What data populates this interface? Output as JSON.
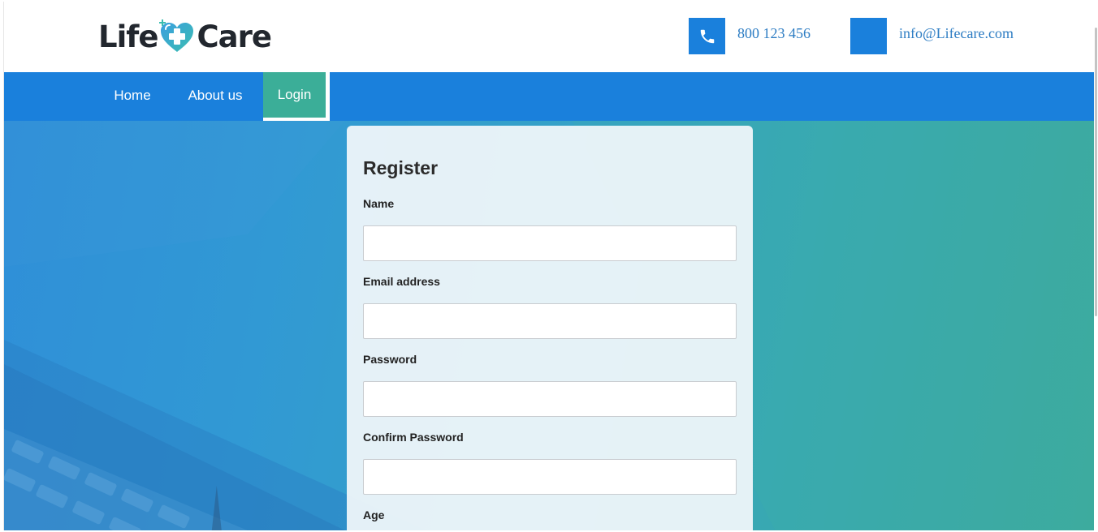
{
  "logo": {
    "part1": "Life",
    "part2": "Care",
    "heart_color": "#3aaed8",
    "cross_color": "#ffffff"
  },
  "contact": {
    "phone": "800 123 456",
    "email": "info@Lifecare.com",
    "phone_icon": "phone-icon",
    "email_icon": "mail-icon",
    "accent": "#1a80dc"
  },
  "nav": {
    "items": [
      {
        "label": "Home"
      },
      {
        "label": "About us"
      },
      {
        "label": "Login",
        "active": true
      }
    ],
    "background": "#1a80dc",
    "active_color": "#3bae98"
  },
  "register": {
    "title": "Register",
    "fields": [
      {
        "label": "Name",
        "value": ""
      },
      {
        "label": "Email address",
        "value": ""
      },
      {
        "label": "Password",
        "value": ""
      },
      {
        "label": "Confirm Password",
        "value": ""
      },
      {
        "label": "Age",
        "value": ""
      }
    ]
  }
}
